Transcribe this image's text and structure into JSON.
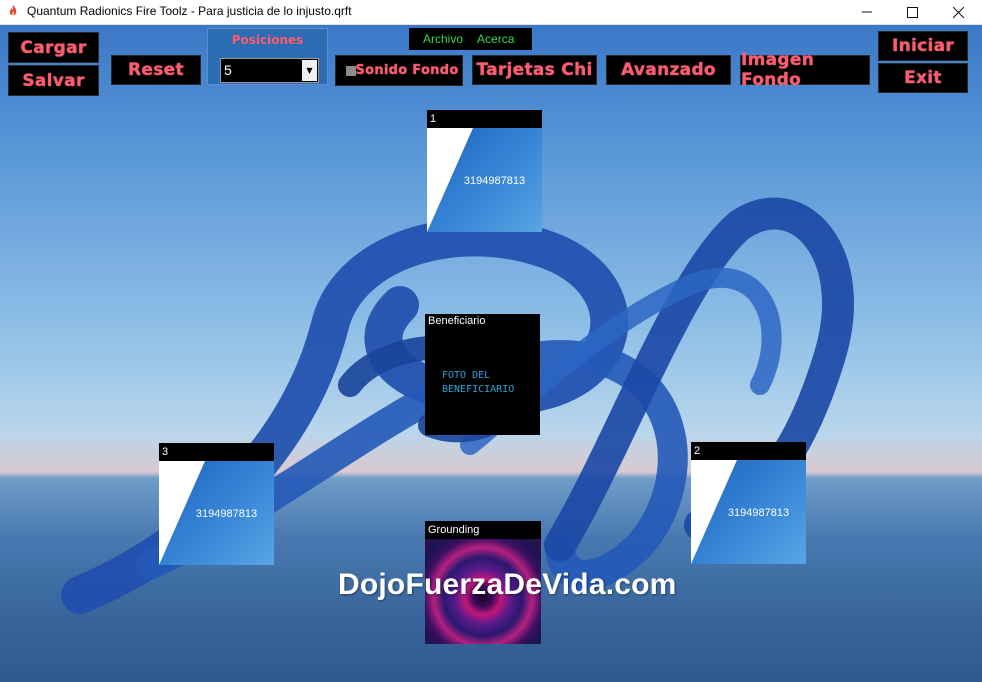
{
  "window": {
    "title": "Quantum Radionics Fire Toolz - Para justicia de lo injusto.qrft",
    "app_icon": "flame-icon",
    "controls": [
      "minimize-icon",
      "maximize-icon",
      "close-icon"
    ]
  },
  "menu": {
    "items": [
      "Archivo",
      "Acerca"
    ],
    "color": "#39d84a"
  },
  "toolbar": {
    "cargar": "Cargar",
    "salvar": "Salvar",
    "reset": "Reset",
    "positions_label": "Posiciones",
    "positions_value": "5",
    "sonido_fondo": "Sonido Fondo",
    "tarjetas_chi": "Tarjetas Chi",
    "avanzado": "Avanzado",
    "imagen_fondo": "Imagen Fondo",
    "iniciar": "Iniciar",
    "exit": "Exit",
    "button_text_color": "#ff5a6e"
  },
  "cards": [
    {
      "label": "1",
      "number": "3194987813"
    },
    {
      "label": "2",
      "number": "3194987813"
    },
    {
      "label": "3",
      "number": "3194987813"
    }
  ],
  "beneficiary": {
    "label": "Beneficiario",
    "photo_line1": "FOTO DEL",
    "photo_line2": "BENEFICIARIO"
  },
  "grounding": {
    "label": "Grounding"
  },
  "watermark": "DojoFuerzaDeVida.com"
}
